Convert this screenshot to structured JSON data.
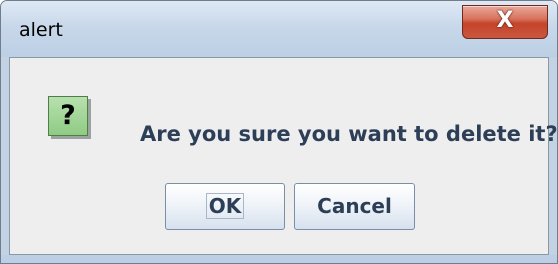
{
  "window": {
    "title": "alert",
    "close_glyph": "X"
  },
  "dialog": {
    "icon": "question-icon",
    "icon_glyph": "?",
    "message": "Are you sure you want to delete it?"
  },
  "buttons": {
    "ok_label": "OK",
    "cancel_label": "Cancel"
  },
  "colors": {
    "titlebar": "#c8d8ea",
    "close_button": "#c4442a",
    "content_bg": "#eeeeee",
    "icon_bg": "#8fcb84",
    "message_text": "#2d3e57"
  }
}
